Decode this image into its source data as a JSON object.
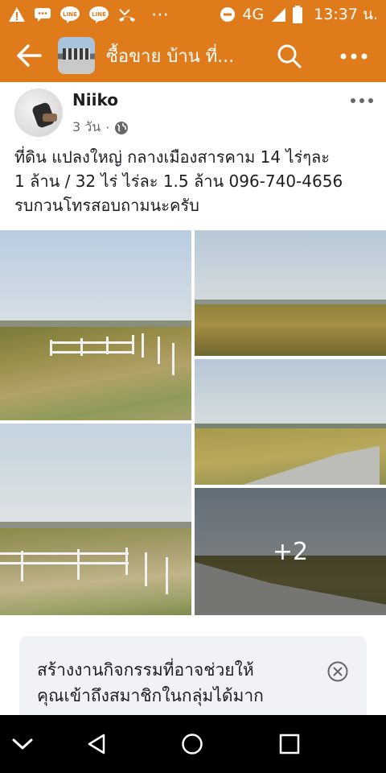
{
  "status_bar": {
    "time": "13:37 น.",
    "network": "4G",
    "dots": "⋯",
    "left_icons": [
      "warning-icon",
      "message-icon",
      "line-icon",
      "line-icon",
      "missed-call-icon"
    ],
    "right_icons": [
      "dnd-icon",
      "signal-icon",
      "battery-icon"
    ]
  },
  "app_bar": {
    "title": "ซื้อขาย บ้าน ที่...",
    "icons": [
      "back-arrow-icon",
      "search-icon",
      "more-icon"
    ]
  },
  "post": {
    "author": "Niiko",
    "time": "3 วัน",
    "separator": "·",
    "audience_icon": "globe-icon",
    "text_line1": "ที่ดิน แปลงใหญ่ กลางเมืองสารคาม 14 ไร่ๆละ",
    "text_line2": "1 ล้าน / 32 ไร่ ไร่ละ 1.5 ล้าน 096-740-4656",
    "text_line3": "รบกวนโทรสอบถามนะครับ",
    "more_photos": "+2"
  },
  "suggestion": {
    "text_line1": "สร้างงานกิจกรรมที่อาจช่วยให้",
    "text_line2": "คุณเข้าถึงสมาชิกในกลุ่มได้มาก",
    "close_icon": "close-circle-icon"
  },
  "nav_bar": {
    "icons": [
      "chevron-down-icon",
      "back-triangle-icon",
      "home-circle-icon",
      "recents-square-icon"
    ]
  },
  "colors": {
    "brand": "#e07b1c",
    "text": "#1c1e21",
    "meta": "#65676b",
    "card": "#f0f2f5"
  }
}
